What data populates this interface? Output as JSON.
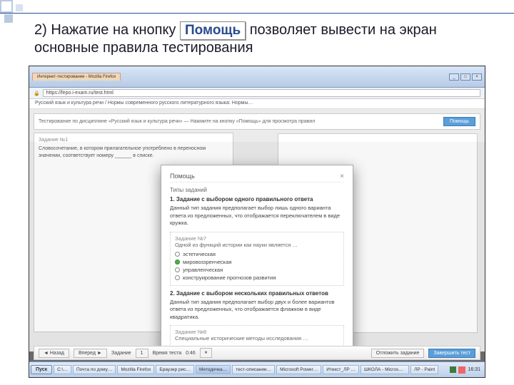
{
  "instruction": {
    "prefix": "2) Нажатие на кнопку",
    "button_label": "Помощь",
    "suffix": "позволяет вывести на экран основные правила тестирования"
  },
  "browser": {
    "tab_title": "Интернет-тестирование - Mozilla Firefox",
    "url": "https://fepo.i-exam.ru/test.html",
    "breadcrumb": "Русский язык и культура речи / Нормы современного русского литературного языка: Нормы…"
  },
  "question_area": {
    "header_left": "Тестирование по дисциплине «Русский язык и культура речи» — Нажмите на кнопку «Помощь» для просмотра правил",
    "help_button": "Помощь",
    "q_number": "Задание №1",
    "q_text": "Словосочетание, в котором прилагательное употреблено в переносном значении, соответствует номеру ______ в списке."
  },
  "modal": {
    "title": "Помощь",
    "subtitle": "Типы заданий",
    "section1_heading": "1. Задание с выбором одного правильного ответа",
    "section1_text": "Данный тип задания предполагает выбор лишь одного варианта ответа из предложенных, что отображается переключателем в виде кружка.",
    "example_label": "Задание №7",
    "example_q": "Одной из функций истории как науки является …",
    "options": [
      {
        "text": "эстетическая",
        "selected": false
      },
      {
        "text": "мировоззренческая",
        "selected": true
      },
      {
        "text": "управленческая",
        "selected": false
      },
      {
        "text": "конструирование прогнозов развития",
        "selected": false
      }
    ],
    "section2_heading": "2. Задание с выбором нескольких правильных ответов",
    "section2_text": "Данный тип задания предполагает выбор двух и более вариантов ответа из предложенных, что отображается флажком в виде квадратика.",
    "example2_label": "Задание №8",
    "example2_q": "Специальные исторические методы исследования …"
  },
  "toolbar": {
    "prev": "◄ Назад",
    "next": "Вперед ►",
    "label_question": "Задание",
    "q_value": "1",
    "label_time": "Время теста",
    "time_value": "0:46",
    "pause": "⏸",
    "right1": "Отложить задание",
    "right2": "Завершить тест"
  },
  "page_strip": {
    "current": "1"
  },
  "taskbar": {
    "start": "Пуск",
    "items": [
      "C:\\…",
      "Почта по дому…",
      "Mozilla Firefox",
      "Браузер рис…",
      "Методичка…",
      "тест-описание…",
      "Microsoft Power…",
      "Итекст_ЛР …",
      "ШКОЛА - Microsof…",
      "ЛР - Paint"
    ],
    "clock": "16:31"
  }
}
